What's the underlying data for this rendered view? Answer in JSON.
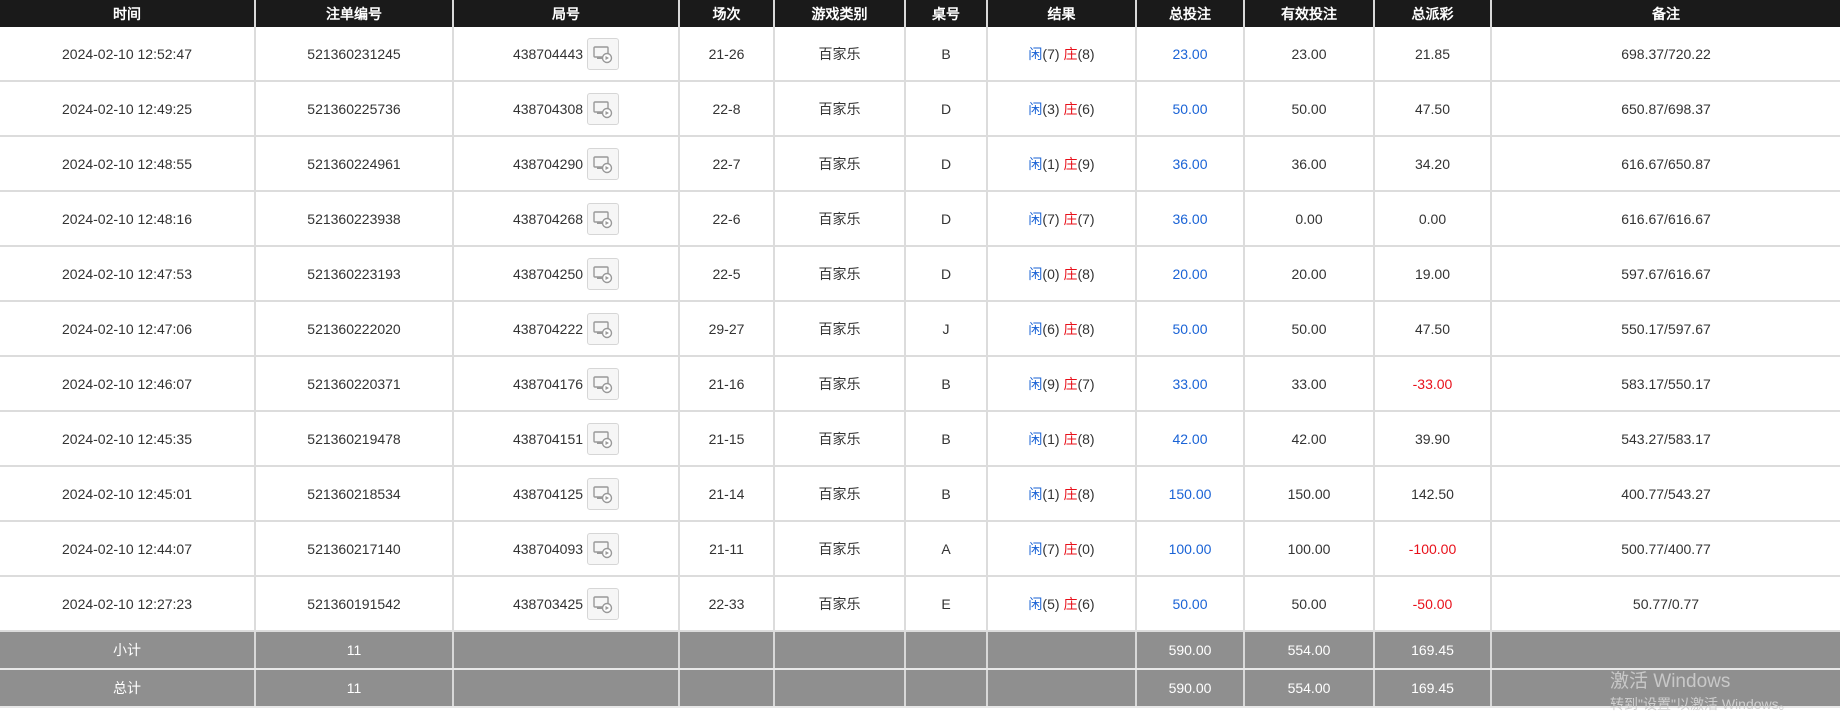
{
  "headers": [
    "时间",
    "注单编号",
    "局号",
    "场次",
    "游戏类别",
    "桌号",
    "结果",
    "总投注",
    "有效投注",
    "总派彩",
    "备注"
  ],
  "rows": [
    {
      "time": "2024-02-10 12:52:47",
      "order": "521360231245",
      "round": "438704443",
      "session": "21-26",
      "game": "百家乐",
      "table": "B",
      "player_label": "闲",
      "player_val": "(7)",
      "banker_label": "庄",
      "banker_val": "(8)",
      "bet": "23.00",
      "valid": "23.00",
      "payout": "21.85",
      "payout_negative": false,
      "note": "698.37/720.22"
    },
    {
      "time": "2024-02-10 12:49:25",
      "order": "521360225736",
      "round": "438704308",
      "session": "22-8",
      "game": "百家乐",
      "table": "D",
      "player_label": "闲",
      "player_val": "(3)",
      "banker_label": "庄",
      "banker_val": "(6)",
      "bet": "50.00",
      "valid": "50.00",
      "payout": "47.50",
      "payout_negative": false,
      "note": "650.87/698.37"
    },
    {
      "time": "2024-02-10 12:48:55",
      "order": "521360224961",
      "round": "438704290",
      "session": "22-7",
      "game": "百家乐",
      "table": "D",
      "player_label": "闲",
      "player_val": "(1)",
      "banker_label": "庄",
      "banker_val": "(9)",
      "bet": "36.00",
      "valid": "36.00",
      "payout": "34.20",
      "payout_negative": false,
      "note": "616.67/650.87"
    },
    {
      "time": "2024-02-10 12:48:16",
      "order": "521360223938",
      "round": "438704268",
      "session": "22-6",
      "game": "百家乐",
      "table": "D",
      "player_label": "闲",
      "player_val": "(7)",
      "banker_label": "庄",
      "banker_val": "(7)",
      "bet": "36.00",
      "valid": "0.00",
      "payout": "0.00",
      "payout_negative": false,
      "note": "616.67/616.67"
    },
    {
      "time": "2024-02-10 12:47:53",
      "order": "521360223193",
      "round": "438704250",
      "session": "22-5",
      "game": "百家乐",
      "table": "D",
      "player_label": "闲",
      "player_val": "(0)",
      "banker_label": "庄",
      "banker_val": "(8)",
      "bet": "20.00",
      "valid": "20.00",
      "payout": "19.00",
      "payout_negative": false,
      "note": "597.67/616.67"
    },
    {
      "time": "2024-02-10 12:47:06",
      "order": "521360222020",
      "round": "438704222",
      "session": "29-27",
      "game": "百家乐",
      "table": "J",
      "player_label": "闲",
      "player_val": "(6)",
      "banker_label": "庄",
      "banker_val": "(8)",
      "bet": "50.00",
      "valid": "50.00",
      "payout": "47.50",
      "payout_negative": false,
      "note": "550.17/597.67"
    },
    {
      "time": "2024-02-10 12:46:07",
      "order": "521360220371",
      "round": "438704176",
      "session": "21-16",
      "game": "百家乐",
      "table": "B",
      "player_label": "闲",
      "player_val": "(9)",
      "banker_label": "庄",
      "banker_val": "(7)",
      "bet": "33.00",
      "valid": "33.00",
      "payout": "-33.00",
      "payout_negative": true,
      "note": "583.17/550.17"
    },
    {
      "time": "2024-02-10 12:45:35",
      "order": "521360219478",
      "round": "438704151",
      "session": "21-15",
      "game": "百家乐",
      "table": "B",
      "player_label": "闲",
      "player_val": "(1)",
      "banker_label": "庄",
      "banker_val": "(8)",
      "bet": "42.00",
      "valid": "42.00",
      "payout": "39.90",
      "payout_negative": false,
      "note": "543.27/583.17"
    },
    {
      "time": "2024-02-10 12:45:01",
      "order": "521360218534",
      "round": "438704125",
      "session": "21-14",
      "game": "百家乐",
      "table": "B",
      "player_label": "闲",
      "player_val": "(1)",
      "banker_label": "庄",
      "banker_val": "(8)",
      "bet": "150.00",
      "valid": "150.00",
      "payout": "142.50",
      "payout_negative": false,
      "note": "400.77/543.27"
    },
    {
      "time": "2024-02-10 12:44:07",
      "order": "521360217140",
      "round": "438704093",
      "session": "21-11",
      "game": "百家乐",
      "table": "A",
      "player_label": "闲",
      "player_val": "(7)",
      "banker_label": "庄",
      "banker_val": "(0)",
      "bet": "100.00",
      "valid": "100.00",
      "payout": "-100.00",
      "payout_negative": true,
      "note": "500.77/400.77"
    },
    {
      "time": "2024-02-10 12:27:23",
      "order": "521360191542",
      "round": "438703425",
      "session": "22-33",
      "game": "百家乐",
      "table": "E",
      "player_label": "闲",
      "player_val": "(5)",
      "banker_label": "庄",
      "banker_val": "(6)",
      "bet": "50.00",
      "valid": "50.00",
      "payout": "-50.00",
      "payout_negative": true,
      "note": "50.77/0.77"
    }
  ],
  "subtotal": {
    "label": "小计",
    "count": "11",
    "bet": "590.00",
    "valid": "554.00",
    "payout": "169.45"
  },
  "total": {
    "label": "总计",
    "count": "11",
    "bet": "590.00",
    "valid": "554.00",
    "payout": "169.45"
  },
  "watermark": {
    "line1": "激活 Windows",
    "line2": "转到\"设置\"以激活 Windows。"
  },
  "colors": {
    "header_bg": "#1a1a1a",
    "sum_bg": "#8f8f8f",
    "blue": "#1a63d6",
    "red": "#e8101a"
  },
  "icons": {
    "replay": "game-replay-icon"
  }
}
